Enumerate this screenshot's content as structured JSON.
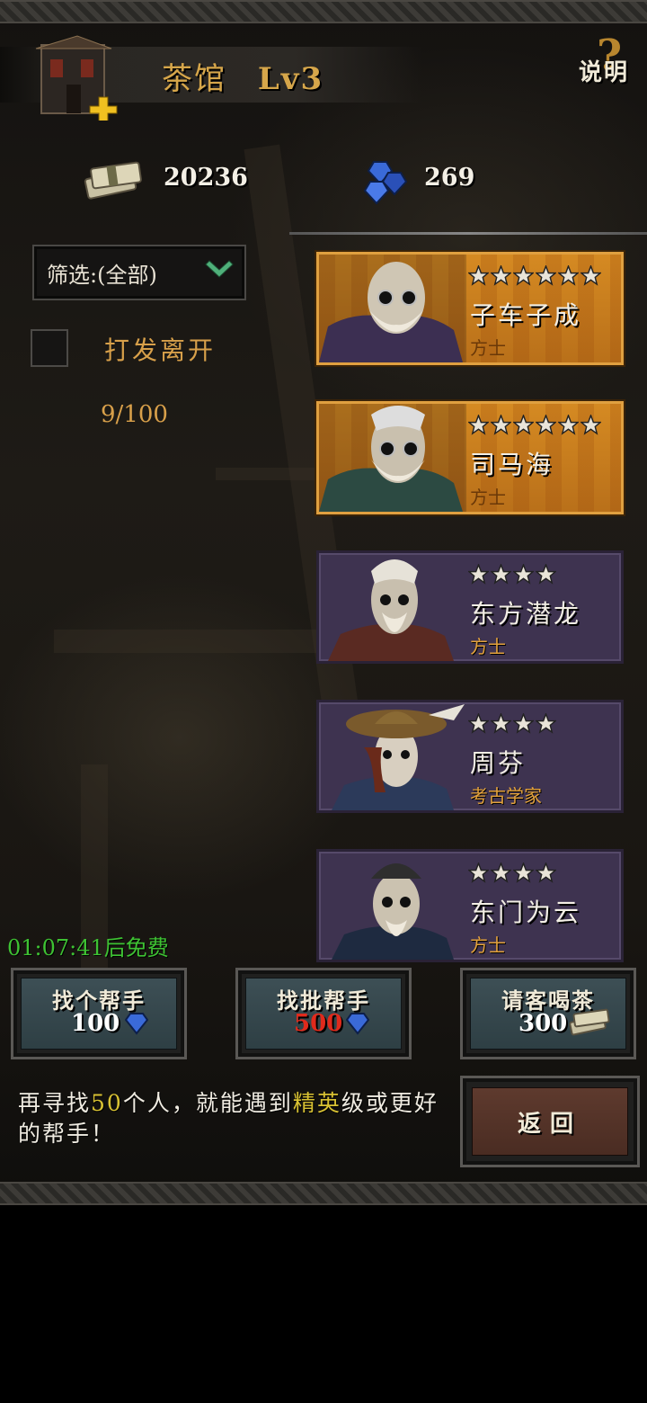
{
  "header": {
    "title": "茶馆",
    "level": "Lv3",
    "help_label": "说明",
    "help_mark": "?"
  },
  "currencies": {
    "money": "20236",
    "gems": "269"
  },
  "filter": {
    "label": "筛选:(全部)"
  },
  "dismiss": {
    "label": "打发离开",
    "checked": false
  },
  "roster_count": "9/100",
  "heroes": [
    {
      "name": "子车子成",
      "class": "方士",
      "stars": 6,
      "rarity": "elite"
    },
    {
      "name": "司马海",
      "class": "方士",
      "stars": 6,
      "rarity": "elite"
    },
    {
      "name": "东方潜龙",
      "class": "方士",
      "stars": 4,
      "rarity": "normal"
    },
    {
      "name": "周芬",
      "class": "考古学家",
      "stars": 4,
      "rarity": "normal"
    },
    {
      "name": "东门为云",
      "class": "方士",
      "stars": 4,
      "rarity": "normal"
    }
  ],
  "timer": "01:07:41后免费",
  "actions": [
    {
      "label": "找个帮手",
      "cost": "100",
      "currency_icon": "gem-icon"
    },
    {
      "label": "找批帮手",
      "cost": "500",
      "currency_icon": "gem-icon",
      "cost_color": "#e02a1c"
    },
    {
      "label": "请客喝茶",
      "cost": "300",
      "currency_icon": "money-icon"
    }
  ],
  "hint": {
    "part1": "再寻找",
    "num": "50",
    "part2": "个人，就能遇到",
    "elite": "精英",
    "part3": "级或更好的帮手！"
  },
  "return_label": "返回",
  "colors": {
    "gold_text": "#d6a64a",
    "elite_card": "#d58a22",
    "normal_card": "#3e3350",
    "timer_green": "#3ec233",
    "highlight_yellow": "#d9c233"
  }
}
